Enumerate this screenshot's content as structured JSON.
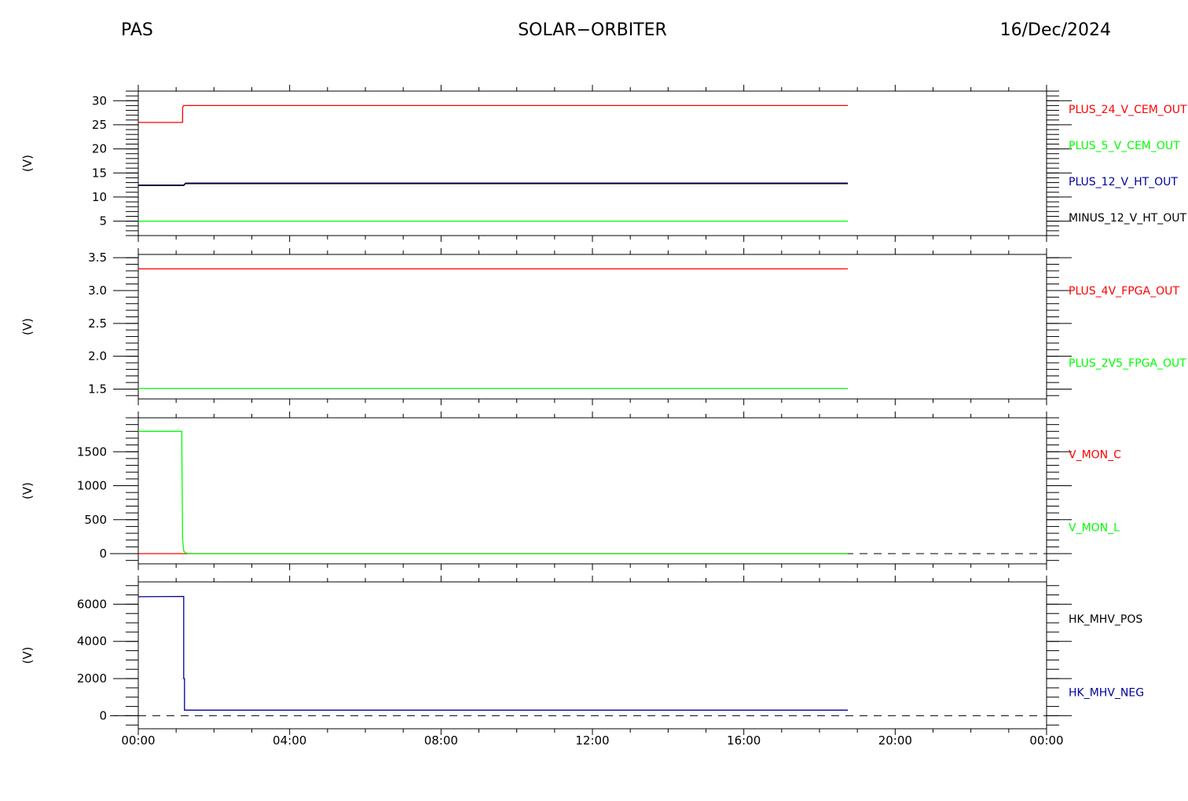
{
  "header": {
    "instrument": "PAS",
    "mission": "SOLAR−ORBITER",
    "date": "16/Dec/2024"
  },
  "colors": {
    "red": "#ff0000",
    "green": "#00ff00",
    "blue": "#0000a0",
    "black": "#000000"
  },
  "chart_data": [
    {
      "type": "line",
      "ylabel": "(V)",
      "ylim": [
        2,
        32
      ],
      "yticks": [
        5,
        10,
        15,
        20,
        25,
        30
      ],
      "ytick_labels": [
        "5",
        "10",
        "15",
        "20",
        "25",
        "30"
      ],
      "yminor": 1,
      "zero_line": false,
      "xlim": [
        0,
        24
      ],
      "series": [
        {
          "name": "PLUS_24_V_CEM_OUT",
          "color": "red",
          "x": [
            0,
            1.17,
            1.17,
            1.2,
            18.75
          ],
          "y": [
            25.5,
            25.5,
            28.6,
            29.0,
            29.0
          ]
        },
        {
          "name": "PLUS_5_V_CEM_OUT",
          "color": "green",
          "x": [
            0,
            18.75
          ],
          "y": [
            5.0,
            5.0
          ]
        },
        {
          "name": "PLUS_12_V_HT_OUT",
          "color": "blue",
          "x": [
            0,
            1.2,
            1.25,
            18.75
          ],
          "y": [
            12.5,
            12.5,
            12.9,
            12.9
          ]
        },
        {
          "name": "MINUS_12_V_HT_OUT",
          "color": "black",
          "x": [
            0,
            1.2,
            1.25,
            18.75
          ],
          "y": [
            12.4,
            12.4,
            12.8,
            12.8
          ]
        }
      ]
    },
    {
      "type": "line",
      "ylabel": "(V)",
      "ylim": [
        1.35,
        3.55
      ],
      "yticks": [
        1.5,
        2.0,
        2.5,
        3.0,
        3.5
      ],
      "ytick_labels": [
        "1.5",
        "2.0",
        "2.5",
        "3.0",
        "3.5"
      ],
      "yminor": 0.1,
      "zero_line": false,
      "xlim": [
        0,
        24
      ],
      "series": [
        {
          "name": "PLUS_4V_FPGA_OUT",
          "color": "red",
          "x": [
            0,
            18.75
          ],
          "y": [
            3.33,
            3.33
          ]
        },
        {
          "name": "PLUS_2V5_FPGA_OUT",
          "color": "green",
          "x": [
            0,
            18.75
          ],
          "y": [
            1.51,
            1.51
          ]
        }
      ]
    },
    {
      "type": "line",
      "ylabel": "(V)",
      "ylim": [
        -150,
        2000
      ],
      "yticks": [
        0,
        500,
        1000,
        1500
      ],
      "ytick_labels": [
        "0",
        "500",
        "1000",
        "1500"
      ],
      "yminor": 100,
      "zero_line": true,
      "xlim": [
        0,
        24
      ],
      "series": [
        {
          "name": "V_MON_C",
          "color": "red",
          "x": [
            0,
            18.75
          ],
          "y": [
            0,
            0
          ]
        },
        {
          "name": "V_MON_L",
          "color": "green",
          "x": [
            0,
            1.15,
            1.15,
            1.17,
            1.2,
            1.25,
            1.35,
            18.75
          ],
          "y": [
            1800,
            1800,
            1600,
            220,
            40,
            10,
            0,
            0
          ]
        }
      ]
    },
    {
      "type": "line",
      "ylabel": "(V)",
      "ylim": [
        -700,
        7200
      ],
      "yticks": [
        0,
        2000,
        4000,
        6000
      ],
      "ytick_labels": [
        "0",
        "2000",
        "4000",
        "6000"
      ],
      "yminor": 500,
      "zero_line": true,
      "xlim": [
        0,
        24
      ],
      "series": [
        {
          "name": "HK_MHV_POS",
          "color": "black",
          "x": [],
          "y": []
        },
        {
          "name": "HK_MHV_NEG",
          "color": "blue",
          "x": [
            0,
            1.2,
            1.2,
            1.22,
            1.22,
            18.75
          ],
          "y": [
            6400,
            6420,
            2000,
            2000,
            300,
            300
          ]
        }
      ]
    }
  ],
  "xaxis": {
    "ticks": [
      0,
      4,
      8,
      12,
      16,
      20,
      24
    ],
    "tick_labels": [
      "00:00",
      "04:00",
      "08:00",
      "12:00",
      "16:00",
      "20:00",
      "00:00"
    ],
    "minor_step": 1
  }
}
